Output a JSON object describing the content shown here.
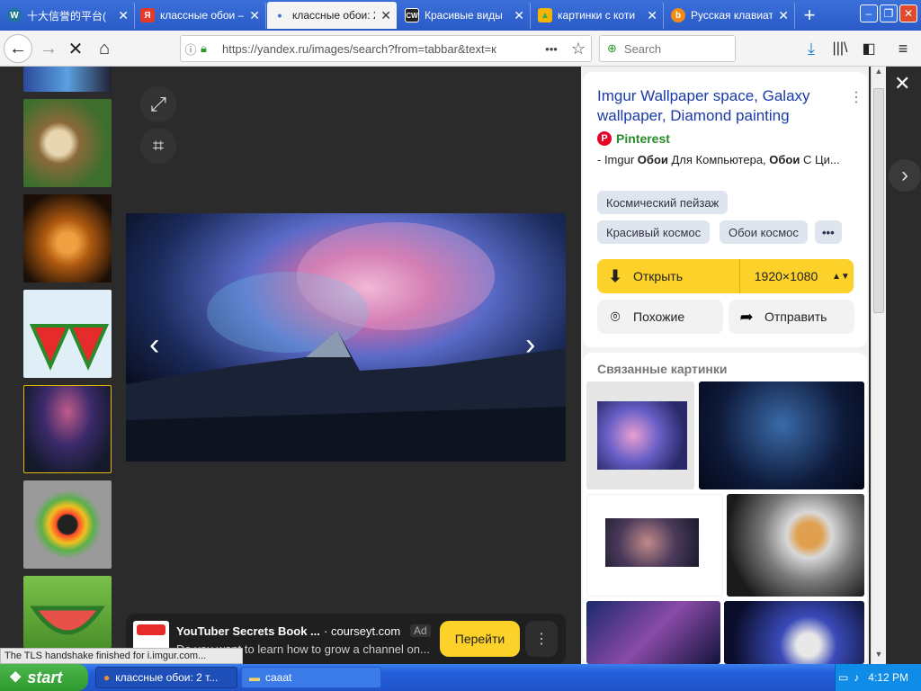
{
  "tabs": [
    {
      "label": "十大信誉的平台(",
      "icon": "wordpress-icon",
      "active": false
    },
    {
      "label": "классные обои — ",
      "icon": "yandex-icon",
      "active": false
    },
    {
      "label": "классные обои: 2",
      "icon": "dot-icon",
      "active": true
    },
    {
      "label": "Красивые виды ",
      "icon": "cw-icon",
      "active": false
    },
    {
      "label": "картинки с коти",
      "icon": "image-icon",
      "active": false
    },
    {
      "label": "Русская клавиат",
      "icon": "keyboard-icon",
      "active": false
    }
  ],
  "new_tab": "+",
  "window_controls": {
    "minimize": "–",
    "maximize": "❐",
    "close": "✕"
  },
  "navbar": {
    "url": "https://yandex.ru/images/search?from=tabbar&text=к",
    "search_placeholder": "Search",
    "more": "•••"
  },
  "viewer": {
    "expand_icon": "expand-icon",
    "crop_icon": "crop-icon",
    "close": "✕",
    "prev": "‹",
    "next": "›",
    "right_arrow": "›"
  },
  "info": {
    "title": "Imgur Wallpaper space, Galaxy wallpaper, Diamond painting",
    "source": "Pinterest",
    "desc_prefix": "- Imgur ",
    "desc_b1": "Обои",
    "desc_mid": " Для Компьютера, ",
    "desc_b2": "Обои",
    "desc_suffix": " С Ци...",
    "tags": [
      "Космический пейзаж",
      "Красивый космос",
      "Обои космос"
    ],
    "more_tags": "•••",
    "open_label": "Открыть",
    "resolution": "1920×1080",
    "similar_label": "Похожие",
    "share_label": "Отправить"
  },
  "related": {
    "title": "Связанные картинки"
  },
  "ad": {
    "title": "YouTuber Secrets Book ...",
    "domain": "· courseyt.com",
    "badge": "Ad",
    "desc": "Do you want to learn how to grow a channel on...",
    "button": "Перейти",
    "menu": "⋮"
  },
  "status_text": "The TLS handshake finished for i.imgur.com...",
  "taskbar": {
    "start": "start",
    "tasks": [
      "классные обои: 2 т...",
      "caaat"
    ],
    "time": "4:12 PM"
  }
}
